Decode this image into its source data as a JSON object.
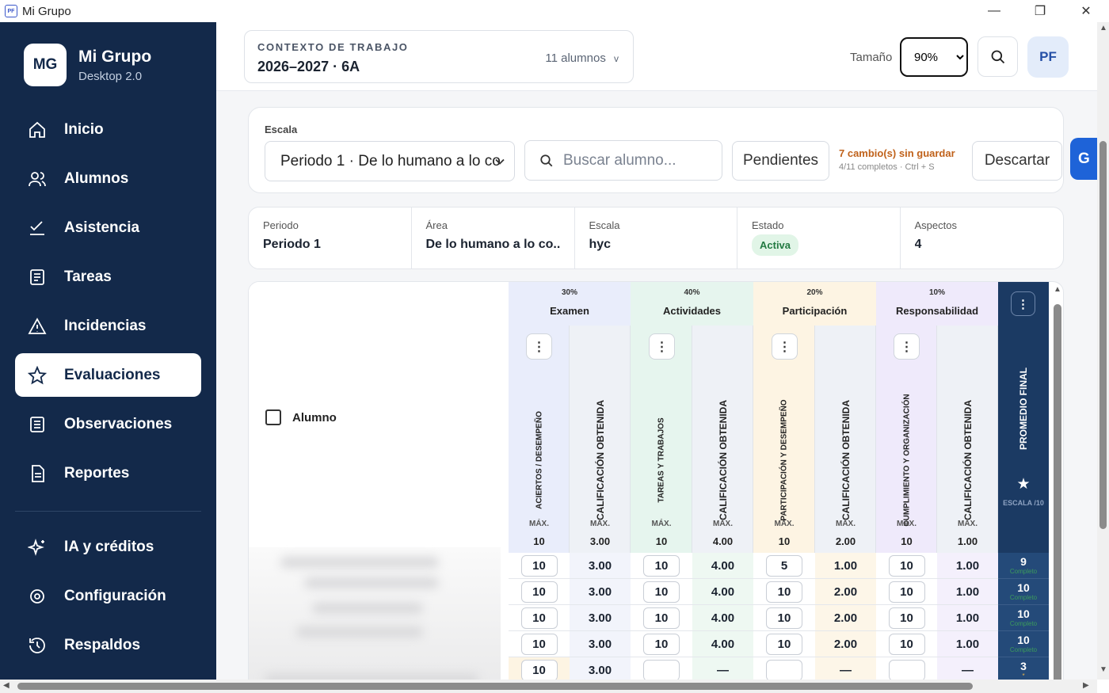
{
  "window": {
    "title": "Mi Grupo",
    "icon_text": "PF",
    "minimize": "—",
    "restore": "❐",
    "close": "✕"
  },
  "sidebar": {
    "logo": "MG",
    "app_name": "Mi Grupo",
    "app_version": "Desktop 2.0",
    "items": [
      {
        "label": "Inicio",
        "icon": "home-icon"
      },
      {
        "label": "Alumnos",
        "icon": "users-icon"
      },
      {
        "label": "Asistencia",
        "icon": "check-list-icon"
      },
      {
        "label": "Tareas",
        "icon": "document-icon"
      },
      {
        "label": "Incidencias",
        "icon": "warning-icon"
      },
      {
        "label": "Evaluaciones",
        "icon": "star-icon",
        "active": true
      },
      {
        "label": "Observaciones",
        "icon": "notes-icon"
      },
      {
        "label": "Reportes",
        "icon": "report-icon"
      },
      {
        "label": "IA y créditos",
        "icon": "sparkles-icon"
      },
      {
        "label": "Configuración",
        "icon": "gear-icon"
      },
      {
        "label": "Respaldos",
        "icon": "history-icon"
      }
    ]
  },
  "topbar": {
    "context_label": "CONTEXTO DE TRABAJO",
    "context_value": "2026–2027 · 6A",
    "student_count": "11 alumnos",
    "size_label": "Tamaño",
    "size_value": "90%",
    "avatar": "PF"
  },
  "filters": {
    "scale_label": "Escala",
    "period_value": "Periodo 1 · De lo humano a lo co",
    "search_placeholder": "Buscar alumno...",
    "pending_button": "Pendientes",
    "unsaved_title": "7 cambio(s) sin guardar",
    "unsaved_sub": "4/11 completos · Ctrl + S",
    "discard_button": "Descartar",
    "save_button": "G"
  },
  "info": [
    {
      "label": "Periodo",
      "value": "Periodo 1"
    },
    {
      "label": "Área",
      "value": "De lo humano a lo co..."
    },
    {
      "label": "Escala",
      "value": "hyc"
    },
    {
      "label": "Estado",
      "value": "Activa"
    },
    {
      "label": "Aspectos",
      "value": "4"
    }
  ],
  "grid": {
    "student_header": "Alumno",
    "max_label": "MÁX.",
    "groups": [
      {
        "pct": "30%",
        "name": "Examen",
        "color": "#e9edfb"
      },
      {
        "pct": "40%",
        "name": "Actividades",
        "color": "#e6f5ee"
      },
      {
        "pct": "20%",
        "name": "Participación",
        "color": "#fdf4e3"
      },
      {
        "pct": "10%",
        "name": "Responsabilidad",
        "color": "#efeafb"
      }
    ],
    "columns": [
      {
        "label": "ACIERTOS / DESEMPEÑO",
        "max": "10"
      },
      {
        "label": "CALIFICACIÓN OBTENIDA",
        "max": "3.00"
      },
      {
        "label": "TAREAS Y TRABAJOS",
        "max": "10"
      },
      {
        "label": "CALIFICACIÓN OBTENIDA",
        "max": "4.00"
      },
      {
        "label": "PARTICIPACIÓN Y DESEMPEÑO",
        "max": "10"
      },
      {
        "label": "CALIFICACIÓN OBTENIDA",
        "max": "2.00"
      },
      {
        "label": "CUMPLIMIENTO Y ORGANIZACIÓN",
        "max": "10"
      },
      {
        "label": "CALIFICACIÓN OBTENIDA",
        "max": "1.00"
      }
    ],
    "final_label": "PROMEDIO FINAL",
    "final_scale": "ESCALA /10",
    "rows": [
      {
        "values": [
          "10",
          "3.00",
          "10",
          "4.00",
          "5",
          "1.00",
          "10",
          "1.00"
        ],
        "final": "9",
        "final_sub": "Completo"
      },
      {
        "values": [
          "10",
          "3.00",
          "10",
          "4.00",
          "10",
          "2.00",
          "10",
          "1.00"
        ],
        "final": "10",
        "final_sub": "Completo"
      },
      {
        "values": [
          "10",
          "3.00",
          "10",
          "4.00",
          "10",
          "2.00",
          "10",
          "1.00"
        ],
        "final": "10",
        "final_sub": "Completo"
      },
      {
        "values": [
          "10",
          "3.00",
          "10",
          "4.00",
          "10",
          "2.00",
          "10",
          "1.00"
        ],
        "final": "10",
        "final_sub": "Completo"
      },
      {
        "values": [
          "10",
          "3.00",
          "",
          "—",
          "",
          "—",
          "",
          "—"
        ],
        "final": "3",
        "final_sub": "*"
      }
    ]
  }
}
